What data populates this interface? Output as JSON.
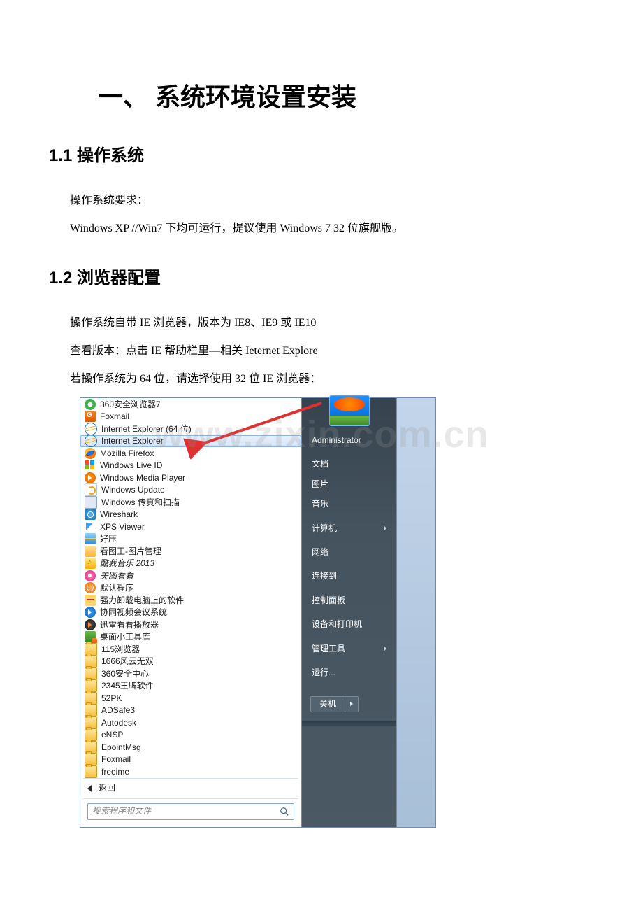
{
  "watermark": "www.zixin.com.cn",
  "doc": {
    "h1": "一、 系统环境设置安装",
    "s1": {
      "title": "1.1  操作系统",
      "p1": "操作系统要求：",
      "p2": "Windows   XP //Win7  下均可运行，提议使用 Windows 7 32 位旗舰版。"
    },
    "s2": {
      "title": "1.2  浏览器配置",
      "p1": "操作系统自带 IE 浏览器，版本为 IE8、IE9 或 IE10",
      "p2": "查看版本：点击 IE 帮助栏里—相关 Ieternet Explore",
      "p3": "若操作系统为 64 位，请选择使用 32 位 IE 浏览器："
    }
  },
  "startmenu": {
    "apps": [
      {
        "label": "360安全浏览器7",
        "icon": "ic-360"
      },
      {
        "label": "Foxmail",
        "icon": "ic-fox"
      },
      {
        "label": "Internet Explorer (64 位)",
        "icon": "ic-ie"
      },
      {
        "label": "Internet Explorer",
        "icon": "ic-ie",
        "highlight": true
      },
      {
        "label": "Mozilla Firefox",
        "icon": "ic-ff"
      },
      {
        "label": "Windows Live ID",
        "icon": "ic-wlive"
      },
      {
        "label": "Windows Media Player",
        "icon": "ic-wmp"
      },
      {
        "label": "Windows Update",
        "icon": "ic-wu"
      },
      {
        "label": "Windows 传真和扫描",
        "icon": "ic-fax"
      },
      {
        "label": "Wireshark",
        "icon": "ic-ws"
      },
      {
        "label": "XPS Viewer",
        "icon": "ic-xps"
      },
      {
        "label": "好压",
        "icon": "ic-hz"
      },
      {
        "label": "看图王-图片管理",
        "icon": "ic-pic"
      },
      {
        "label": "酷我音乐 2013",
        "icon": "ic-music",
        "italic": true
      },
      {
        "label": "美图看看",
        "icon": "ic-meitu",
        "italic": true
      },
      {
        "label": "默认程序",
        "icon": "ic-default"
      },
      {
        "label": "强力卸载电脑上的软件",
        "icon": "ic-uninst"
      },
      {
        "label": "协同视频会议系统",
        "icon": "ic-video"
      },
      {
        "label": "迅雷看看播放器",
        "icon": "ic-xl"
      },
      {
        "label": "桌面小工具库",
        "icon": "ic-widget"
      },
      {
        "label": "115浏览器",
        "icon": "ic-folder"
      },
      {
        "label": "1666风云无双",
        "icon": "ic-folder"
      },
      {
        "label": "360安全中心",
        "icon": "ic-folder"
      },
      {
        "label": "2345王牌软件",
        "icon": "ic-folder"
      },
      {
        "label": "52PK",
        "icon": "ic-folder"
      },
      {
        "label": "ADSafe3",
        "icon": "ic-folder"
      },
      {
        "label": "Autodesk",
        "icon": "ic-folder"
      },
      {
        "label": "eNSP",
        "icon": "ic-folder"
      },
      {
        "label": "EpointMsg",
        "icon": "ic-folder"
      },
      {
        "label": "Foxmail",
        "icon": "ic-folder"
      },
      {
        "label": "freeime",
        "icon": "ic-folder"
      }
    ],
    "back": "返回",
    "search_placeholder": "搜索程序和文件",
    "right": {
      "username": "Administrator",
      "items": [
        {
          "label": "文档"
        },
        {
          "label": "图片"
        },
        {
          "label": "音乐"
        },
        {
          "label": "计算机",
          "arrow": true
        },
        {
          "label": "网络"
        },
        {
          "label": "连接到"
        },
        {
          "label": "控制面板"
        },
        {
          "label": "设备和打印机"
        },
        {
          "label": "管理工具",
          "arrow": true
        },
        {
          "label": "运行..."
        }
      ],
      "shutdown": "关机"
    }
  }
}
